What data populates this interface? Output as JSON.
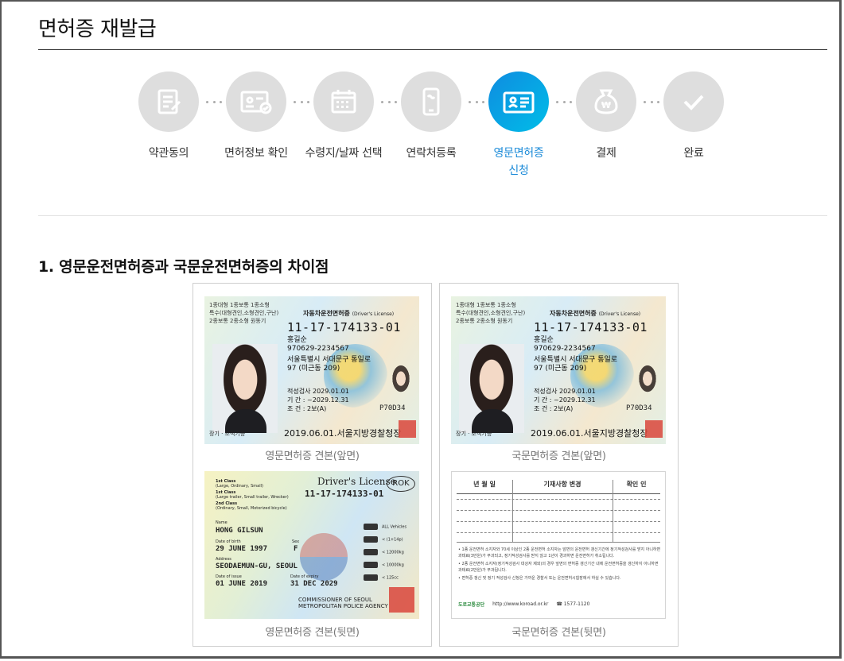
{
  "page": {
    "title": "면허증 재발급",
    "section_heading": "1. 영문운전면허증과 국문운전면허증의 차이점"
  },
  "steps": [
    {
      "label": "약관동의",
      "label2": "",
      "icon": "document-edit-icon",
      "active": false
    },
    {
      "label": "면허정보 확인",
      "label2": "",
      "icon": "id-card-check-icon",
      "active": false
    },
    {
      "label": "수령지/날짜 선택",
      "label2": "",
      "icon": "calendar-icon",
      "active": false
    },
    {
      "label": "연락처등록",
      "label2": "",
      "icon": "mobile-phone-icon",
      "active": false
    },
    {
      "label": "영문면허증",
      "label2": "신청",
      "icon": "license-card-icon",
      "active": true
    },
    {
      "label": "결제",
      "label2": "",
      "icon": "money-bag-won-icon",
      "active": false
    },
    {
      "label": "완료",
      "label2": "",
      "icon": "checkmark-icon",
      "active": false
    }
  ],
  "colors": {
    "active_gradient_start": "#0f8ce0",
    "active_gradient_end": "#00bde8",
    "inactive_circle": "#dedede",
    "active_label": "#1a8ad8"
  },
  "cards": {
    "english_front_caption": "영문면허증 견본(앞면)",
    "korean_front_caption": "국문면허증 견본(앞면)",
    "english_back_caption": "영문면허증 견본(뒷면)",
    "korean_back_caption": "국문면허증 견본(뒷면)"
  },
  "license_front": {
    "class_line1": "1종대형  1종보통  1종소형",
    "class_line2": "특수(대형견인,소형견인,구난)",
    "class_line3": "2종보통  2종소형  원동기",
    "header": "자동차운전면허증",
    "header_en": "(Driver's License)",
    "number": "11-17-174133-01",
    "name": "홍길순",
    "rrn": "970629-2234567",
    "address1": "서울특별시 서대문구 통일로",
    "address2": "97 (미근동 209)",
    "aptitude": "적성검사   2029.01.01",
    "period": "기    간 : ~2029.12.31",
    "condition": "조    건 : 2보(A)",
    "code": "P70D34",
    "issue": "2019.06.01.서울지방경찰청장",
    "bottom_label": "장기 · 조직기증"
  },
  "license_eng_back": {
    "title": "Driver's License",
    "rok": "ROK",
    "number": "11-17-174133-01",
    "class1": "1st Class",
    "class1_desc": "(Large, Ordinary, Small)",
    "class1b": "1st Class",
    "class1b_desc": "(Large trailer, Small trailer, Wrecker)",
    "class2": "2nd Class",
    "class2_desc": "(Ordinary, Small, Motorized bicycle)",
    "name_label": "Name",
    "name": "HONG GILSUN",
    "dob_label": "Date of birth",
    "dob": "29 JUNE 1997",
    "sex_label": "Sex",
    "sex": "F",
    "address_label": "Address",
    "address": "SEODAEMUN-GU, SEOUL",
    "issue_label": "Date of issue",
    "issue": "01 JUNE 2019",
    "expiry_label": "Date of expiry",
    "expiry": "31 DEC 2029",
    "authority1": "COMMISSIONER OF SEOUL",
    "authority2": "METROPOLITAN POLICE AGENCY",
    "vehicles": [
      "ALL Vehicles",
      "< (1+14p)",
      "< 12000kg",
      "< 10000kg",
      "< 125cc"
    ]
  },
  "license_kor_back": {
    "col1": "년  월  일",
    "col2": "기재사항 변경",
    "col3": "확인 인",
    "note1": "• 1종 운전면허 소지자와 70세 이상인 2종 운전면허 소지자는 앞면의 운전면허 갱신기간에 정기적성검사를 받지 아니하면 과태료(3만원)가 부과되고, 정기적성검사를 받지 않고 1년이 경과하면 운전면허가 취소됩니다.",
    "note2": "• 2종 운전면허 소지자(정기적성검사 대상자 제외)의 경우 앞면의 면허증 갱신기간 내에 운전면허증을 갱신하지 아니하면 과태료(2만원)가 부과됩니다.",
    "note3": "• 면허증 갱신 및 정기 적성검사 신청은 가까운 경찰서 또는 운전면허시험장에서 하실 수 있습니다.",
    "logo": "도로교통공단",
    "url": "http://www.koroad.or.kr",
    "phone": "☎ 1577-1120"
  }
}
